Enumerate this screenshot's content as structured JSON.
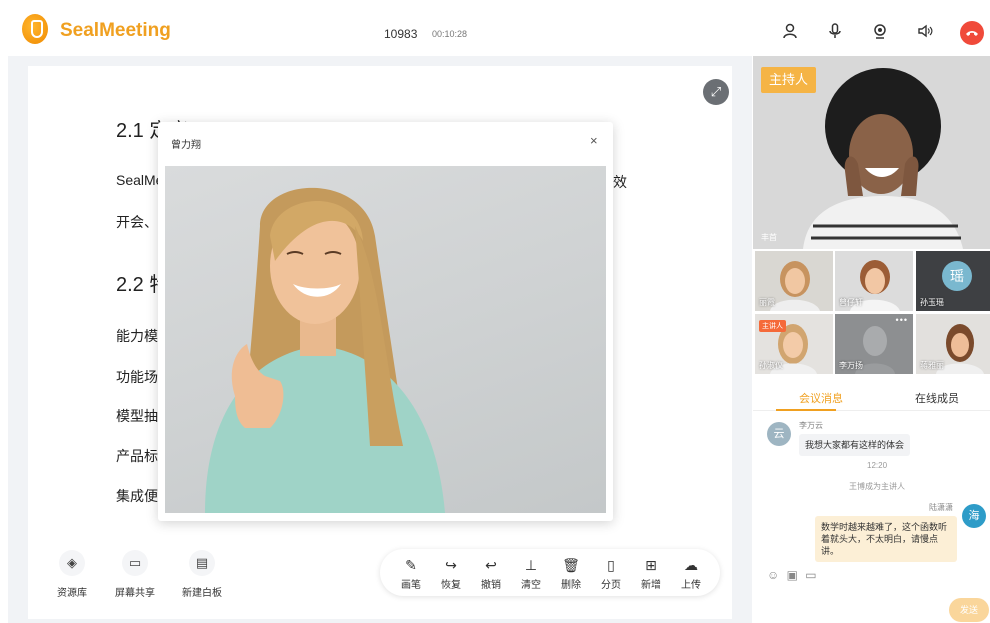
{
  "header": {
    "app_name": "SealMeeting",
    "room_id": "10983",
    "timer": "00:10:28",
    "brand_color": "#f0a020",
    "icons": [
      "member-icon",
      "microphone-icon",
      "camera-icon",
      "speaker-icon",
      "hangup-icon"
    ]
  },
  "document": {
    "h1": "2.1 定义",
    "line1_start": "SealMe",
    "line1_end": "效",
    "line2": "开会、",
    "h2": "2.2 特",
    "items": [
      "能力模",
      "功能场",
      "模型抽",
      "产品标",
      "集成便"
    ]
  },
  "floating_window": {
    "title": "曾力翔",
    "close": "×"
  },
  "left_tools": [
    {
      "label": "资源库",
      "icon": "resource-icon"
    },
    {
      "label": "屏幕共享",
      "icon": "screen-share-icon"
    },
    {
      "label": "新建白板",
      "icon": "whiteboard-icon"
    }
  ],
  "whiteboard_tools": [
    {
      "label": "画笔",
      "icon": "pen-icon"
    },
    {
      "label": "恢复",
      "icon": "redo-icon"
    },
    {
      "label": "撤销",
      "icon": "undo-icon"
    },
    {
      "label": "清空",
      "icon": "clear-icon"
    },
    {
      "label": "删除",
      "icon": "delete-icon"
    },
    {
      "label": "分页",
      "icon": "page-icon"
    },
    {
      "label": "新增",
      "icon": "add-icon"
    },
    {
      "label": "上传",
      "icon": "upload-icon"
    }
  ],
  "right_panel": {
    "host_badge": "主持人",
    "main_name": "丰首",
    "thumbs": [
      {
        "name": "丽霞"
      },
      {
        "name": "曾仔轩"
      },
      {
        "name": "孙玉瑶",
        "avatar": "瑶"
      },
      {
        "name": "孙淑仪",
        "badge": "主讲人"
      },
      {
        "name": "李万扬"
      },
      {
        "name": "蒋雅丽"
      }
    ],
    "tabs": [
      "会议消息",
      "在线成员"
    ],
    "messages": {
      "m1_name": "李万云",
      "m1_avatar": "云",
      "m1_text": "我想大家都有这样的体会",
      "time": "12:20",
      "system": "王博成为主讲人",
      "m2_name": "陆潇潇",
      "m2_avatar": "海",
      "m2_text": "数学时越来越难了，这个函数听着就头大，不太明白，请慢点讲。"
    },
    "send": "发送"
  }
}
